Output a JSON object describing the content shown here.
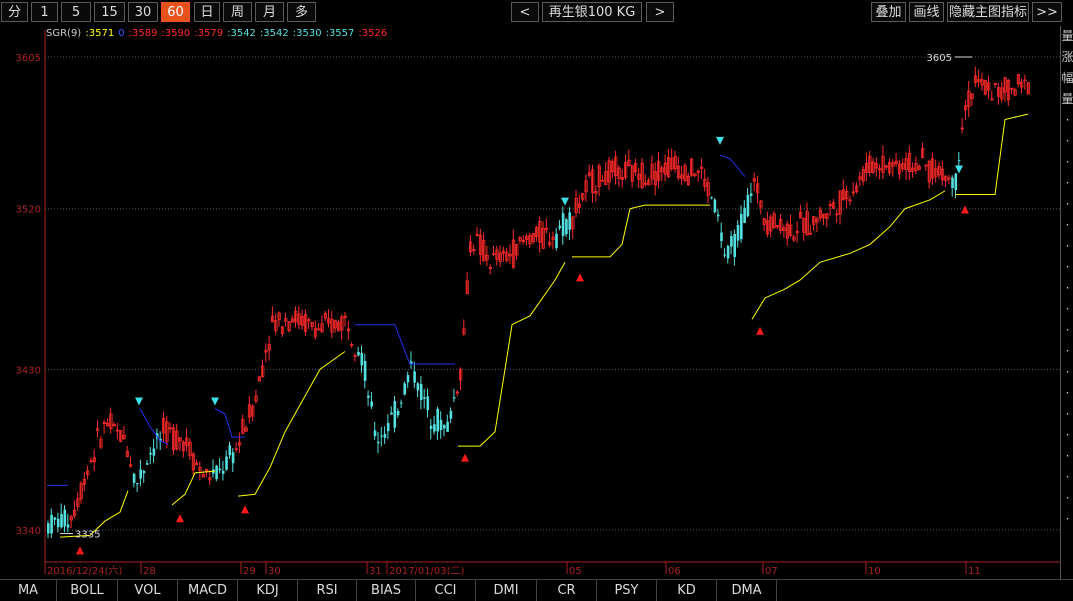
{
  "toolbar": {
    "periods": [
      {
        "label": "分",
        "active": false
      },
      {
        "label": "1",
        "active": false
      },
      {
        "label": "5",
        "active": false
      },
      {
        "label": "15",
        "active": false
      },
      {
        "label": "30",
        "active": false
      },
      {
        "label": "60",
        "active": true
      },
      {
        "label": "日",
        "active": false
      },
      {
        "label": "周",
        "active": false
      },
      {
        "label": "月",
        "active": false
      },
      {
        "label": "多",
        "active": false
      }
    ],
    "prev": "<",
    "instrument": "再生银100 KG",
    "next": ">",
    "overlay": "叠加",
    "draw": "画线",
    "hide_indicator": "隐藏主图指标",
    "more": ">>"
  },
  "legend": {
    "name": "SGR(9)",
    "values": [
      {
        "text": ":3571",
        "color": "#ffff00"
      },
      {
        "text": "0",
        "color": "#3355ff"
      },
      {
        "text": ":3589",
        "color": "#ff2a2a"
      },
      {
        "text": ":3590",
        "color": "#ff2a2a"
      },
      {
        "text": ":3579",
        "color": "#ff2a2a"
      },
      {
        "text": ":3542",
        "color": "#55e0e0"
      },
      {
        "text": ":3542",
        "color": "#55e0e0"
      },
      {
        "text": ":3530",
        "color": "#55e0e0"
      },
      {
        "text": ":3557",
        "color": "#55e0e0"
      },
      {
        "text": ":3526",
        "color": "#ff2a2a"
      }
    ]
  },
  "chart_data": {
    "type": "candlestick",
    "y_ticks": [
      "3605",
      "3520",
      "3430",
      "3340"
    ],
    "x_ticks": [
      "2016/12/24(六)",
      "28",
      "29",
      "30",
      "31",
      "2017/01/03(二)",
      "05",
      "06",
      "07",
      "10",
      "11"
    ],
    "low_annotation": "3335",
    "high_annotation": "3605",
    "colors": {
      "up": "#ff2a2a",
      "down": "#55e0e0",
      "stop_long": "#ffff00",
      "stop_short": "#2233ee",
      "grid": "#555555",
      "axis": "#aa2222"
    }
  },
  "side_panel": [
    "量",
    "涨",
    "幅",
    "量"
  ],
  "tabs": [
    "MA",
    "BOLL",
    "VOL",
    "MACD",
    "KDJ",
    "RSI",
    "BIAS",
    "CCI",
    "DMI",
    "CR",
    "PSY",
    "KD",
    "DMA"
  ]
}
